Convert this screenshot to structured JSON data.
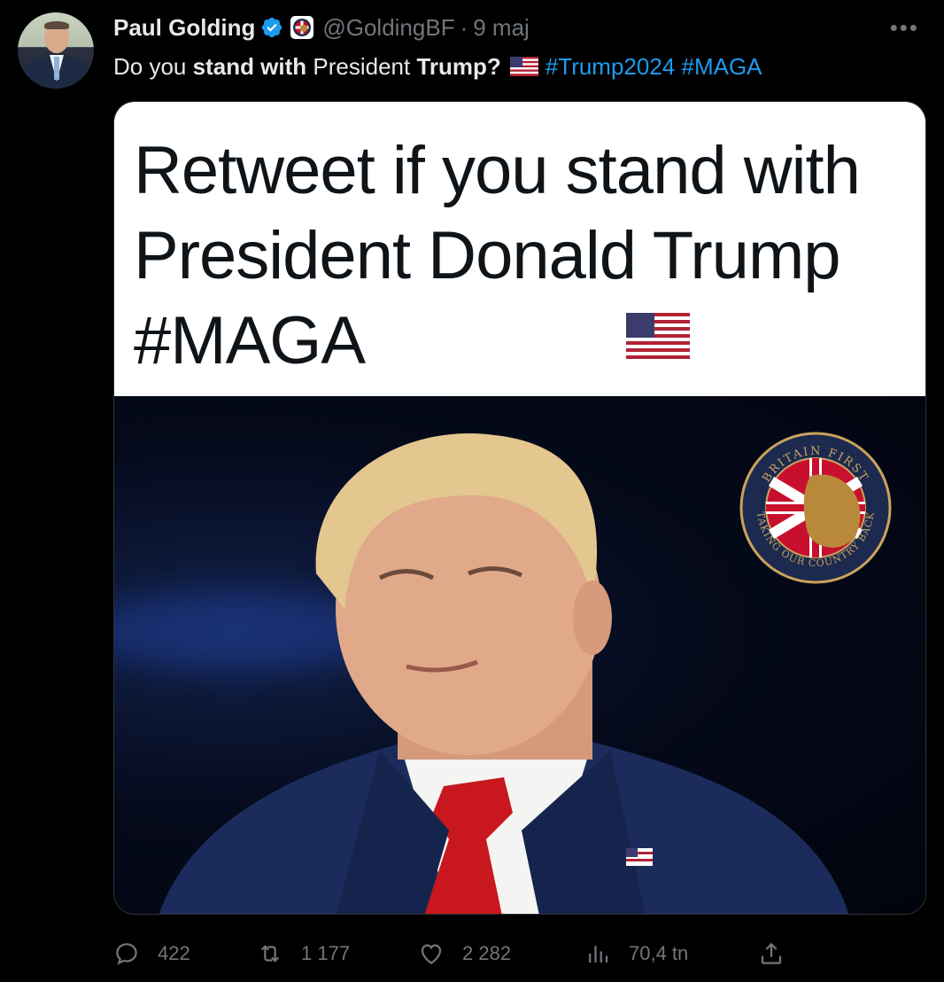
{
  "author": {
    "name": "Paul Golding",
    "handle": "@GoldingBF",
    "separator": "·",
    "time": "9 maj"
  },
  "tweet": {
    "prefix": "Do you ",
    "bold1": "stand with",
    "middle": " President ",
    "bold2": "Trump?",
    "hashtags": [
      "#Trump2024",
      "#MAGA"
    ]
  },
  "media": {
    "caption": "Retweet if you stand with President Donald Trump #MAGA",
    "badge": {
      "top_text": "BRITAIN FIRST",
      "bottom_text": "TAKING OUR COUNTRY BACK"
    }
  },
  "actions": {
    "replies": "422",
    "retweets": "1 177",
    "likes": "2 282",
    "views": "70,4 tn"
  },
  "colors": {
    "background": "#000000",
    "text": "#e7e9ea",
    "muted": "#71767b",
    "link": "#1d9bf0",
    "verified": "#1d9bf0"
  }
}
